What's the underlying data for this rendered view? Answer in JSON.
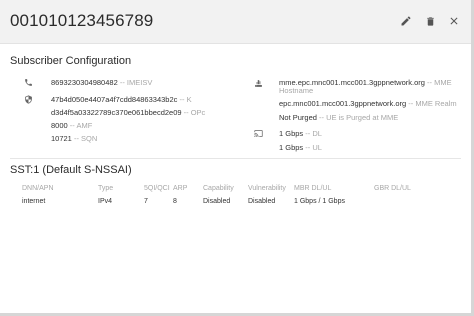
{
  "header": {
    "title": "001010123456789"
  },
  "subscriber_configuration": {
    "heading": "Subscriber Configuration",
    "imeisv": {
      "value": "8693230304980482",
      "label": "IMEISV"
    },
    "k": {
      "value": "47b4d050e4407a4f7cdd84863343b2c",
      "label": "K"
    },
    "opc": {
      "value": "d3d4f5a03322789c370e061bbecd2e09",
      "label": "OPc"
    },
    "amf": {
      "value": "8000",
      "label": "AMF"
    },
    "sqn": {
      "value": "10721",
      "label": "SQN"
    },
    "mme_hostname": {
      "value": "mme.epc.mnc001.mcc001.3gppnetwork.org",
      "label": "MME Hostname"
    },
    "mme_realm": {
      "value": "epc.mnc001.mcc001.3gppnetwork.org",
      "label": "MME Realm"
    },
    "purge": {
      "value": "Not Purged",
      "label": "UE is Purged at MME"
    },
    "ambr_dl": {
      "value": "1 Gbps",
      "label": "DL"
    },
    "ambr_ul": {
      "value": "1 Gbps",
      "label": "UL"
    },
    "separator": " -- "
  },
  "slice": {
    "heading": "SST:1 (Default S-NSSAI)",
    "columns": [
      "DNN/APN",
      "Type",
      "5QI/QCI",
      "ARP",
      "Capability",
      "Vulnerability",
      "MBR DL/UL",
      "GBR DL/UL"
    ],
    "rows": [
      [
        "internet",
        "IPv4",
        "7",
        "8",
        "Disabled",
        "Disabled",
        "1 Gbps / 1 Gbps",
        ""
      ]
    ]
  },
  "icons": {
    "edit": "pencil-icon",
    "delete": "trash-icon",
    "close": "close-icon",
    "phone": "phone-icon",
    "security": "shield-icon",
    "server": "server-icon",
    "cast": "cast-icon"
  },
  "colors": {
    "header_bg": "#f2f2f2",
    "hint": "#a7a7a7",
    "text": "#333333"
  }
}
